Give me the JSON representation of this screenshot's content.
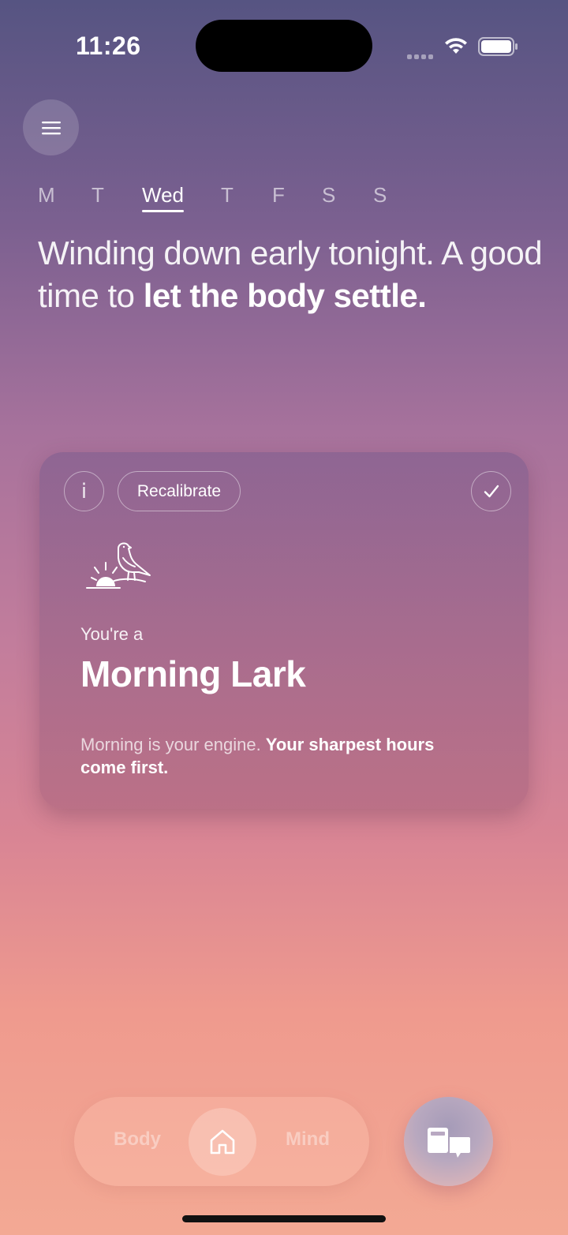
{
  "status_bar": {
    "time": "11:26"
  },
  "week": {
    "days": [
      "M",
      "T",
      "Wed",
      "T",
      "F",
      "S",
      "S"
    ],
    "active_index": 2
  },
  "headline": {
    "prefix": "Winding down early tonight. A good time to ",
    "emphasis": "let the body settle."
  },
  "card": {
    "info_label": "i",
    "recalibrate_label": "Recalibrate",
    "intro": "You're a",
    "chronotype": "Morning Lark",
    "description_plain": "Morning is your engine. ",
    "description_bold": "Your sharpest hours come first."
  },
  "tabbar": {
    "left_label": "Body",
    "right_label": "Mind"
  },
  "icons": [
    "menu-icon",
    "info-icon",
    "check-icon",
    "bird-sunrise-icon",
    "home-icon",
    "chat-icon",
    "wifi-icon",
    "battery-icon"
  ]
}
